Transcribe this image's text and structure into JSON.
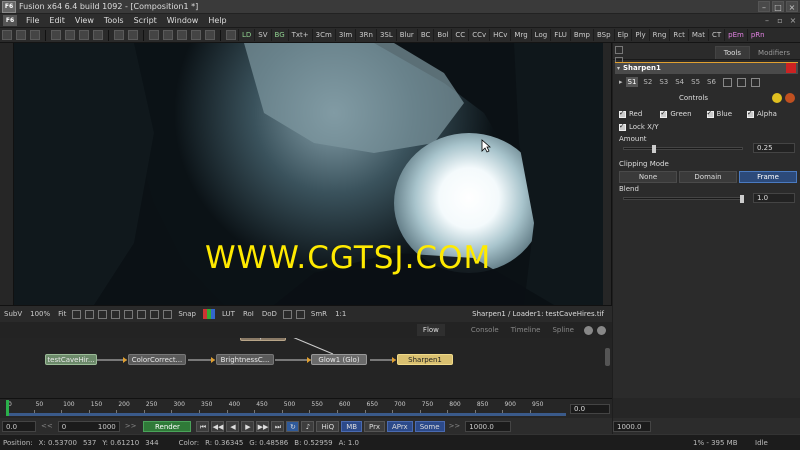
{
  "window": {
    "title": "Fusion x64 6.4 build 1092 - [Composition1 *]",
    "app_icon": "F6"
  },
  "menubar": {
    "logo": "F6",
    "items": [
      "File",
      "Edit",
      "View",
      "Tools",
      "Script",
      "Window",
      "Help"
    ]
  },
  "toolbar": {
    "tools": [
      "LD",
      "SV",
      "BG",
      "Txt+",
      "3Cm",
      "3Im",
      "3Rn",
      "3SL",
      "Blur",
      "BC",
      "Bol",
      "CC",
      "CCv",
      "HCv",
      "Mrg",
      "Log",
      "FLU",
      "Bmp",
      "BSp",
      "Elp",
      "Ply",
      "Rng",
      "Rct",
      "Mat",
      "CT",
      "pEm",
      "pRn"
    ]
  },
  "viewer": {
    "watermark": "WWW.CGTSJ.COM",
    "toolbar": {
      "subv": "SubV",
      "zoom": "100%",
      "fit": "Fit",
      "snap": "Snap",
      "lut": "LUT",
      "roi": "RoI",
      "dod": "DoD",
      "smr": "SmR",
      "ratio": "1:1",
      "path": "Sharpen1 / Loader1: testCaveHires.tif"
    }
  },
  "panel": {
    "tabs": [
      "Tools",
      "Modifiers"
    ],
    "tool_name": "Sharpen1",
    "subtabs": [
      "S1",
      "S2",
      "S3",
      "S4",
      "S5",
      "S6"
    ],
    "controls_label": "Controls",
    "channels": [
      "Red",
      "Green",
      "Blue",
      "Alpha"
    ],
    "lock_xy": "Lock X/Y",
    "amount_label": "Amount",
    "amount_value": "0.25",
    "amount_fraction": 0.25,
    "clipping_label": "Clipping Mode",
    "clip_options": [
      "None",
      "Domain",
      "Frame"
    ],
    "clip_selected": "Frame",
    "blend_label": "Blend",
    "blend_value": "1.0",
    "blend_fraction": 1.0
  },
  "flow": {
    "tabs": [
      "Flow",
      "Console",
      "Timeline",
      "Spline"
    ],
    "nodes": {
      "loader": "testCaveHir...",
      "colorcorrect": "ColorCorrect...",
      "brightness": "BrightnessC...",
      "ellipse": "Ellipse1",
      "glow": "Glow1 (Glo)",
      "sharpen": "Sharpen1"
    }
  },
  "timeline": {
    "ticks": [
      "0",
      "50",
      "100",
      "150",
      "200",
      "250",
      "300",
      "350",
      "400",
      "450",
      "500",
      "550",
      "600",
      "650",
      "700",
      "750",
      "800",
      "850",
      "900",
      "950"
    ],
    "current": "0.0",
    "start": "0.0",
    "render_start": "0",
    "render_end": "1000",
    "render_label": "Render",
    "render_end_field": "1000.0",
    "global_end": "1000.0",
    "options": [
      "HiQ",
      "MB",
      "Prx",
      "APrx",
      "Some"
    ],
    "nav": "<<",
    "nav2": ">>"
  },
  "status": {
    "position_label": "Position:",
    "x": "X: 0.53700",
    "px": "537",
    "y": "Y: 0.61210",
    "py": "344",
    "color_label": "Color:",
    "r": "R: 0.36345",
    "g": "G: 0.48586",
    "b": "B: 0.52959",
    "a": "A: 1.0",
    "memory": "1% - 395 MB",
    "state": "Idle"
  }
}
